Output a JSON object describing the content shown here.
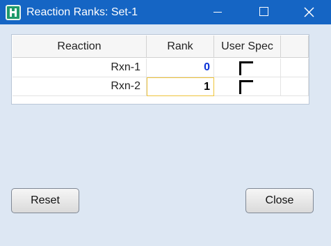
{
  "window": {
    "title": "Reaction Ranks: Set-1",
    "controls": {
      "minimize_icon": "minimize-icon",
      "maximize_icon": "maximize-icon",
      "close_icon": "close-icon"
    }
  },
  "grid": {
    "columns": [
      "Reaction",
      "Rank",
      "User Spec"
    ],
    "rows": [
      {
        "reaction": "Rxn-1",
        "rank": "0",
        "user_spec": false
      },
      {
        "reaction": "Rxn-2",
        "rank": "1",
        "user_spec": false
      }
    ]
  },
  "buttons": {
    "reset": "Reset",
    "close": "Close"
  },
  "colors": {
    "titlebar": "#1565c4",
    "background": "#dde7f3",
    "rank_blue": "#0b33d6",
    "selection": "#efc43a"
  }
}
